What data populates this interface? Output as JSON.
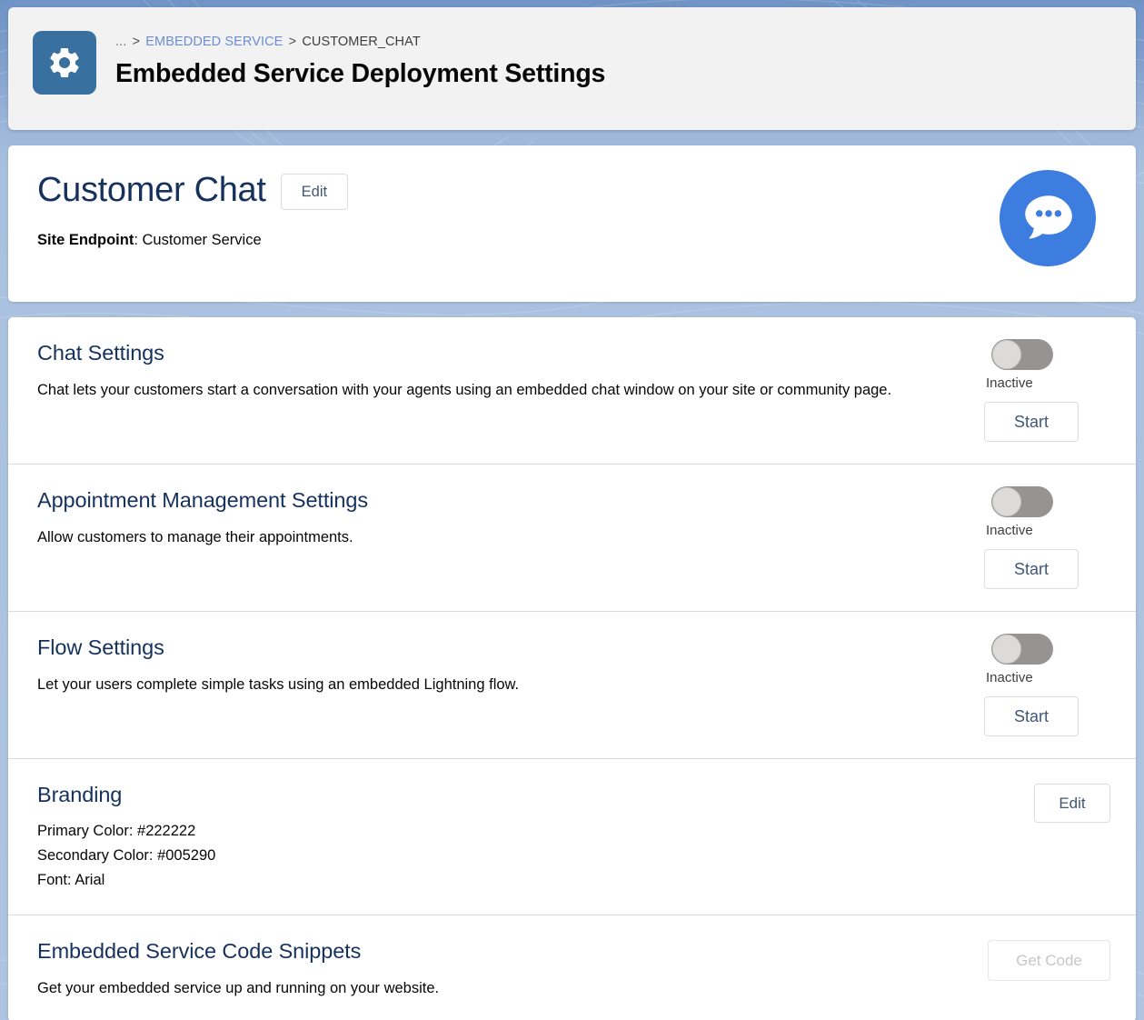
{
  "header": {
    "app_icon": "gear-icon",
    "breadcrumb": {
      "ellipsis": "...",
      "separator": ">",
      "parent": "EMBEDDED SERVICE",
      "current": "CUSTOMER_CHAT"
    },
    "title": "Embedded Service Deployment Settings",
    "icon_background": "#38709F"
  },
  "summary": {
    "deployment_name": "Customer Chat",
    "edit_label": "Edit",
    "site_endpoint_label": "Site Endpoint",
    "site_endpoint_separator": ": ",
    "site_endpoint_value": "Customer Service",
    "badge_icon": "chat-bubble-icon",
    "badge_color": "#3C7DDF"
  },
  "settings": [
    {
      "id": "chat",
      "title": "Chat Settings",
      "description": "Chat lets your customers start a conversation with your agents using an embedded chat window on your site or community page.",
      "toggle_state": "off",
      "status_label": "Inactive",
      "action_label": "Start",
      "action_disabled": false
    },
    {
      "id": "appointment-management",
      "title": "Appointment Management Settings",
      "description": "Allow customers to manage their appointments.",
      "toggle_state": "off",
      "status_label": "Inactive",
      "action_label": "Start",
      "action_disabled": false
    },
    {
      "id": "flow",
      "title": "Flow Settings",
      "description": "Let your users complete simple tasks using an embedded Lightning flow.",
      "toggle_state": "off",
      "status_label": "Inactive",
      "action_label": "Start",
      "action_disabled": false
    }
  ],
  "branding": {
    "title": "Branding",
    "primary_color_line": "Primary Color: #222222",
    "secondary_color_line": "Secondary Color: #005290",
    "font_line": "Font: Arial",
    "primary_color": "#222222",
    "secondary_color": "#005290",
    "font_value": "Arial",
    "action_label": "Edit"
  },
  "code_snippets": {
    "title": "Embedded Service Code Snippets",
    "description": "Get your embedded service up and running on your website.",
    "action_label": "Get Code",
    "action_disabled": true
  },
  "theme": {
    "background_blue": "#A9C1E0",
    "card_white": "#FFFFFF",
    "header_card_gray": "#F3F2F2",
    "link_blue": "#6C8DD0",
    "heading_navy": "#16325C",
    "button_text": "#3F5877",
    "toggle_track": "#969492",
    "toggle_knob": "#DDDBDA",
    "divider": "#DDDBDA"
  }
}
